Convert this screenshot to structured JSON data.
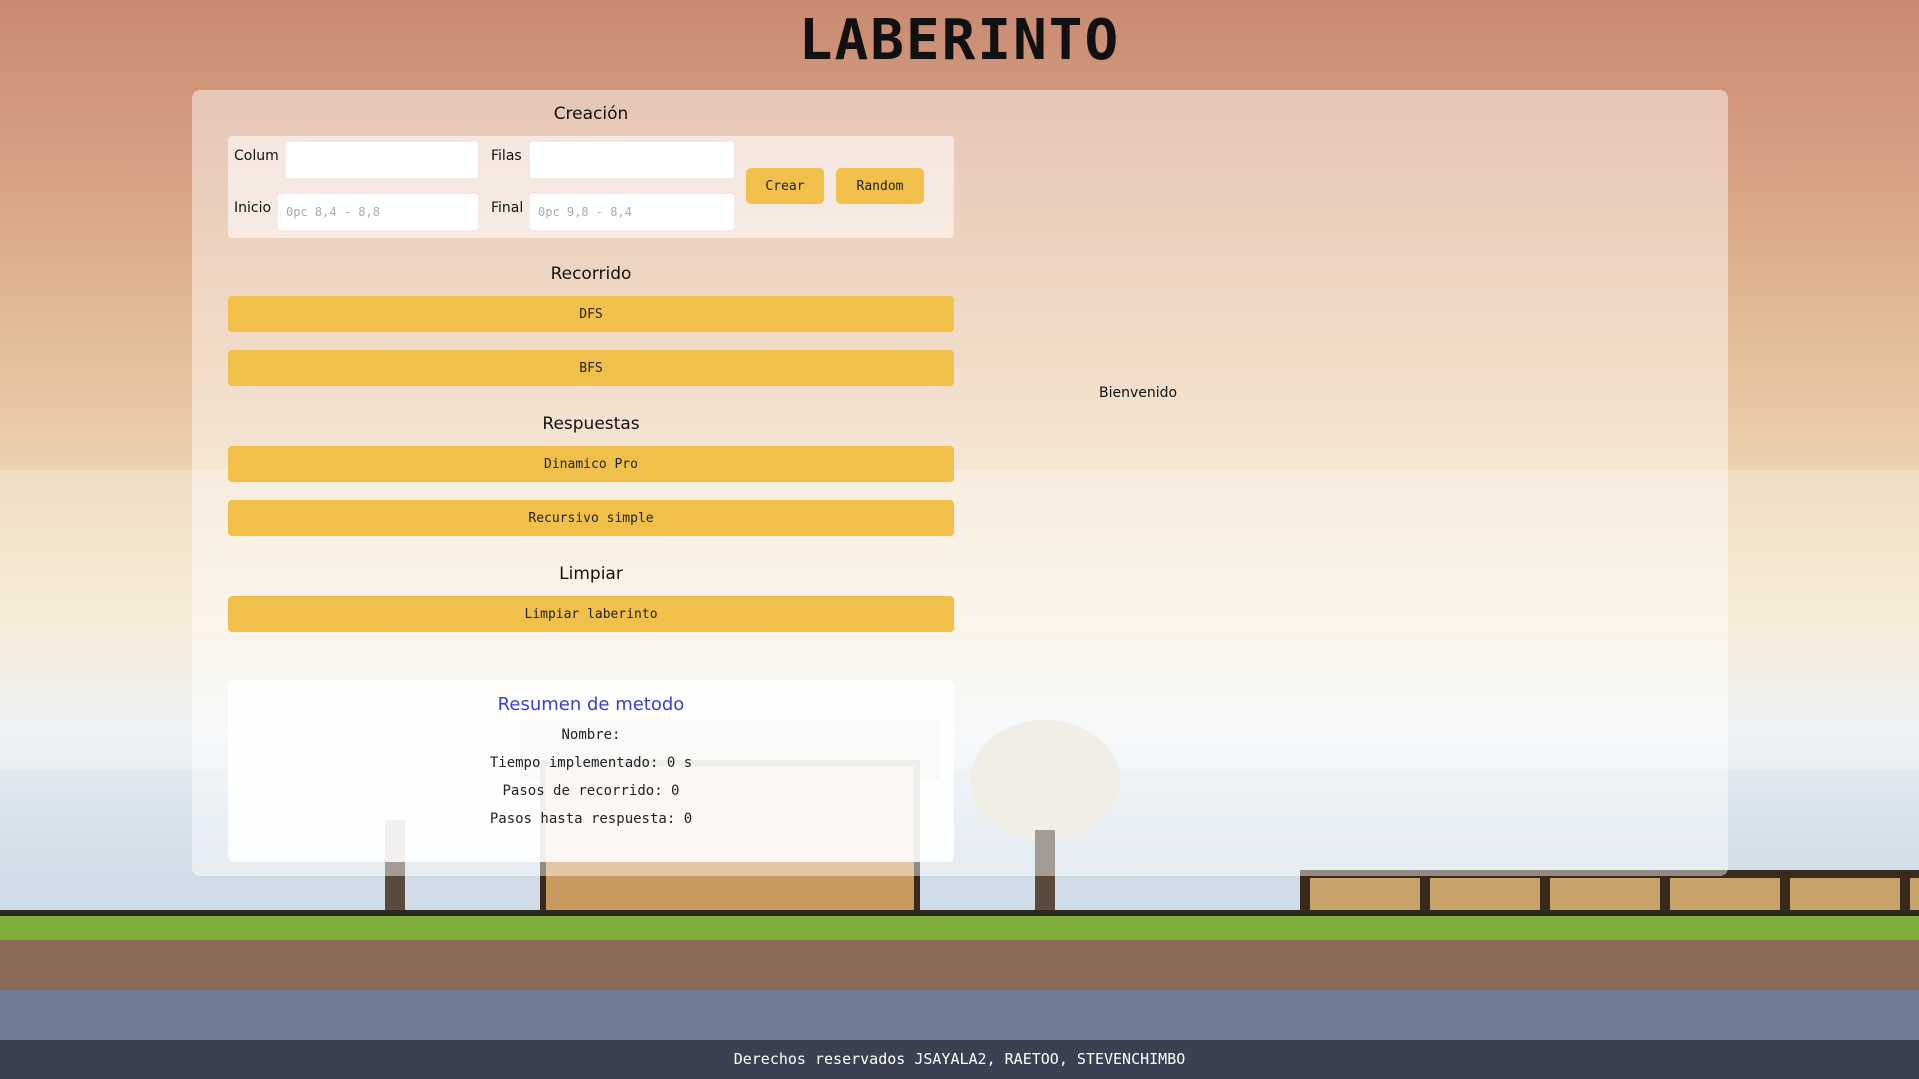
{
  "header": {
    "title": "LABERINTO"
  },
  "creacion": {
    "title": "Creación",
    "colum_label": "Colum",
    "colum_value": "",
    "filas_label": "Filas",
    "filas_value": "",
    "inicio_label": "Inicio",
    "inicio_placeholder": "0pc 8,4 - 8,8",
    "final_label": "Final",
    "final_placeholder": "0pc 9,8 - 8,4",
    "crear_label": "Crear",
    "random_label": "Random"
  },
  "recorrido": {
    "title": "Recorrido",
    "dfs_label": "DFS",
    "bfs_label": "BFS"
  },
  "respuestas": {
    "title": "Respuestas",
    "dinamico_label": "Dinamico Pro",
    "recursivo_label": "Recursivo simple"
  },
  "limpiar": {
    "title": "Limpiar",
    "limpiar_label": "Limpiar laberinto"
  },
  "summary": {
    "title": "Resumen de metodo",
    "nombre": "Nombre:",
    "tiempo": "Tiempo implementado: 0 s",
    "pasos_recorrido": "Pasos de recorrido: 0",
    "pasos_respuesta": "Pasos hasta respuesta: 0"
  },
  "main": {
    "welcome": "Bienvenido"
  },
  "footer": {
    "text": "Derechos reservados JSAYALA2, RAETOO, STEVENCHIMBO"
  },
  "colors": {
    "button": "#f0c04a",
    "footer_bg": "#3b4150",
    "summary_title": "#3b3bd6"
  }
}
